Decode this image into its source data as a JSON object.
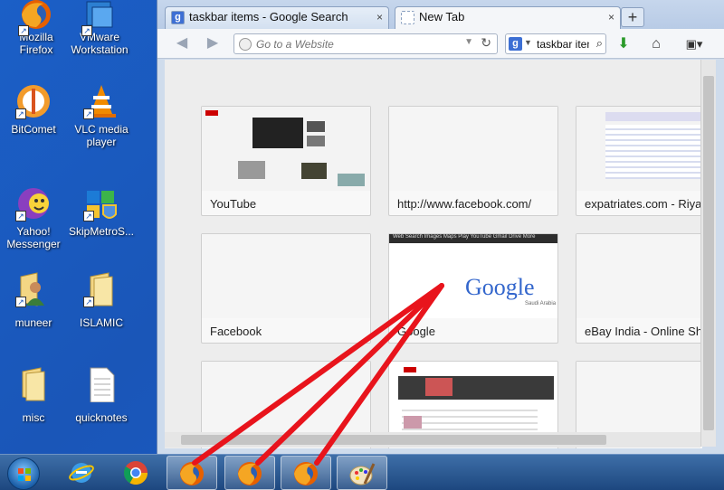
{
  "desktop": {
    "icons": [
      {
        "label": "Mozilla\nFirefox",
        "icon": "firefox-icon"
      },
      {
        "label": "VMware\nWorkstation",
        "icon": "vmware-icon"
      },
      {
        "label": "BitComet",
        "icon": "bitcomet-icon"
      },
      {
        "label": "VLC media\nplayer",
        "icon": "vlc-icon"
      },
      {
        "label": "Yahoo!\nMessenger",
        "icon": "yahoo-messenger-icon"
      },
      {
        "label": "SkipMetroS...",
        "icon": "skipmetro-icon"
      },
      {
        "label": "muneer",
        "icon": "user-folder-icon"
      },
      {
        "label": "ISLAMIC",
        "icon": "folder-icon"
      },
      {
        "label": "misc",
        "icon": "folder-icon"
      },
      {
        "label": "quicknotes",
        "icon": "text-file-icon"
      }
    ]
  },
  "browser": {
    "tabs": [
      {
        "label": "taskbar items - Google Search",
        "favicon": "google-favicon",
        "active": false
      },
      {
        "label": "New Tab",
        "favicon": "blank-page-favicon",
        "active": true
      }
    ],
    "new_tab_label": "+",
    "close_label": "×",
    "url_placeholder": "Go to a Website",
    "search_engine": "g",
    "search_value": "taskbar items",
    "tiles": [
      {
        "label": "YouTube"
      },
      {
        "label": "http://www.facebook.com/"
      },
      {
        "label": "expatriates.com - Riyadh"
      },
      {
        "label": "Facebook"
      },
      {
        "label": "Google"
      },
      {
        "label": "eBay India - Online Shop"
      },
      {
        "label": ""
      },
      {
        "label": ""
      },
      {
        "label": ""
      }
    ],
    "google_logo": "Google",
    "google_sub": "Saudi Arabia",
    "google_nav": "Web  Search  Images  Maps  Play  YouTube  Gmail  Drive  More"
  },
  "taskbar": {
    "items": [
      {
        "icon": "windows-start-orb",
        "running": false
      },
      {
        "icon": "internet-explorer-icon",
        "running": false
      },
      {
        "icon": "chrome-icon",
        "running": false
      },
      {
        "icon": "firefox-icon",
        "running": true
      },
      {
        "icon": "firefox-icon",
        "running": true
      },
      {
        "icon": "firefox-icon",
        "running": true
      },
      {
        "icon": "paint-icon",
        "running": true
      }
    ]
  },
  "colors": {
    "desktop": "#1b5fc7",
    "annotation_arrows": "#e8141c"
  }
}
